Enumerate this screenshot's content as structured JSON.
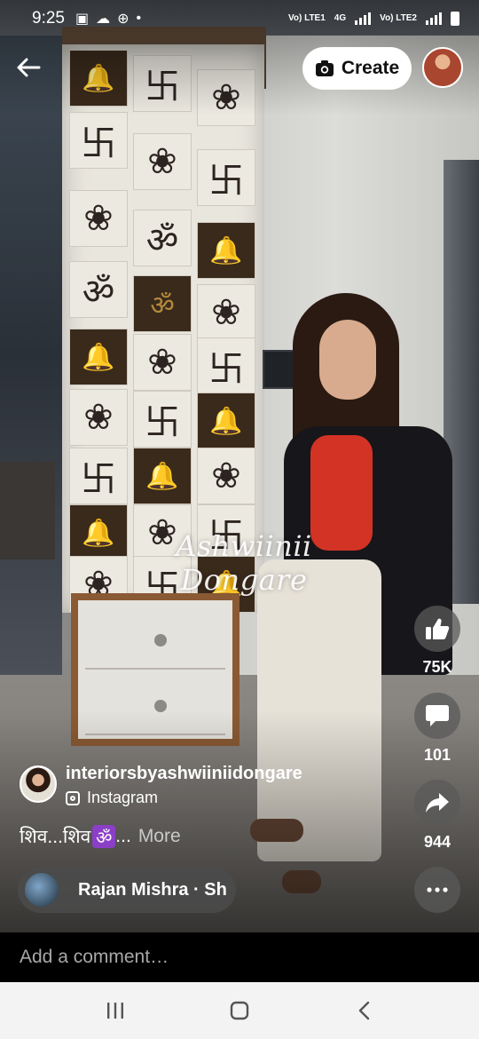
{
  "status_bar": {
    "time": "9:25",
    "network_1": "Vo) LTE1",
    "network_2": "4G",
    "network_3": "Vo) LTE2"
  },
  "top": {
    "back_icon": "arrow-left-icon",
    "create_label": "Create",
    "create_icon": "camera-icon"
  },
  "video": {
    "watermark": "Ashwiinii Dongare"
  },
  "actions": {
    "like_count": "75K",
    "comment_count": "101",
    "share_count": "944",
    "like_icon": "thumbs-up-icon",
    "comment_icon": "speech-bubble-icon",
    "share_icon": "share-arrow-icon",
    "more_icon": "more-horizontal-icon"
  },
  "post": {
    "author": "interiorsbyashwiiniidongare",
    "source": "Instagram",
    "caption": "शिव...शिव",
    "caption_emoji": "ॐ",
    "caption_ellipsis": "...",
    "more_label": "More"
  },
  "audio": {
    "label": "Rajan Mishra · Sh"
  },
  "comment": {
    "placeholder": "Add a comment…"
  },
  "nav": {
    "recents_icon": "recents-icon",
    "home_icon": "home-icon",
    "back_icon": "back-icon"
  },
  "colors": {
    "create_bg": "#ffffff",
    "rail_button_bg": "#5a5a5a",
    "om_badge": "#8b3fc7",
    "nav_bg": "#f3f3f3"
  }
}
